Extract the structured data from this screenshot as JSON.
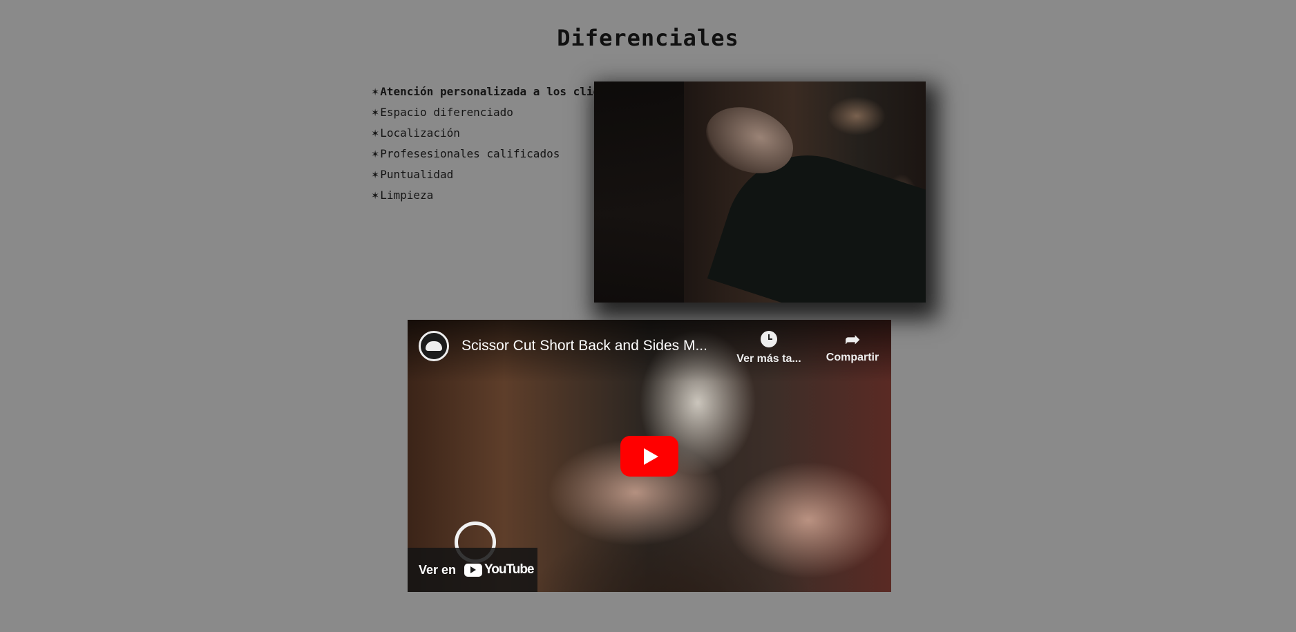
{
  "section": {
    "title": "Diferenciales"
  },
  "features": [
    {
      "bullet": "✶",
      "label": "Atención personalizada a los clientes"
    },
    {
      "bullet": "✶",
      "label": "Espacio diferenciado"
    },
    {
      "bullet": "✶",
      "label": "Localización"
    },
    {
      "bullet": "✶",
      "label": "Profesesionales calificados"
    },
    {
      "bullet": "✶",
      "label": "Puntualidad"
    },
    {
      "bullet": "✶",
      "label": "Limpieza"
    }
  ],
  "video": {
    "title": "Scissor Cut Short Back and Sides M...",
    "watch_later_label": "Ver más ta...",
    "share_label": "Compartir",
    "watch_on_label": "Ver en",
    "youtube_wordmark": "YouTube",
    "play_button_color": "#ff0000"
  },
  "colors": {
    "page_background": "#8a8a8a"
  }
}
